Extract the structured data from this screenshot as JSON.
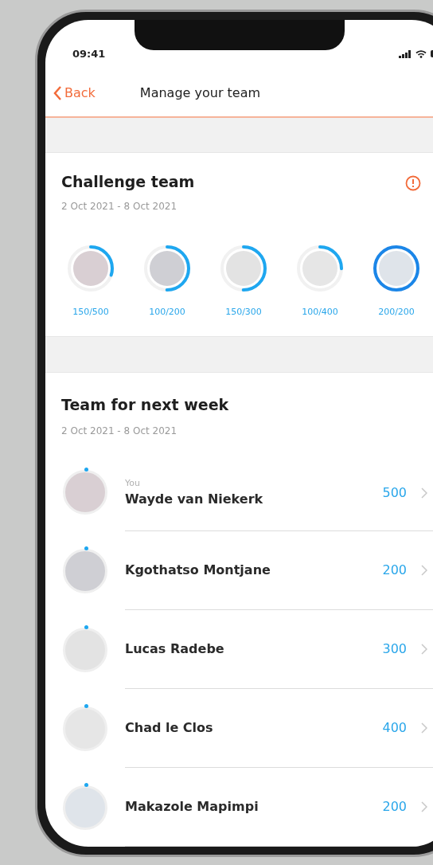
{
  "status_bar": {
    "time": "09:41"
  },
  "nav": {
    "back": "Back",
    "title": "Manage your team"
  },
  "challenge": {
    "title": "Challenge team",
    "dates": "2 Oct 2021 - 8 Oct 2021",
    "members": [
      {
        "progress": "150/500",
        "level": 0.3
      },
      {
        "progress": "100/200",
        "level": 0.5
      },
      {
        "progress": "150/300",
        "level": 0.5
      },
      {
        "progress": "100/400",
        "level": 0.25
      },
      {
        "progress": "200/200",
        "level": 1
      }
    ]
  },
  "next_week": {
    "title": "Team for next week",
    "dates": "2 Oct 2021 - 8 Oct 2021",
    "members": [
      {
        "caption": "You",
        "name": "Wayde van Niekerk",
        "value": "500"
      },
      {
        "name": "Kgothatso Montjane",
        "value": "200"
      },
      {
        "name": "Lucas Radebe",
        "value": "300"
      },
      {
        "name": "Chad le Clos",
        "value": "400"
      },
      {
        "name": "Makazole Mapimpi",
        "value": "200"
      }
    ]
  }
}
